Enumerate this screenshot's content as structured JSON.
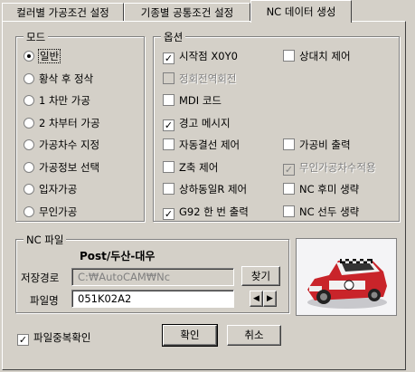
{
  "tabs": [
    {
      "label": "컬러별 가공조건 설정"
    },
    {
      "label": "기종별 공통조건 설정"
    },
    {
      "label": "NC 데이터 생성"
    }
  ],
  "mode_group": {
    "title": "모드",
    "options": [
      {
        "label": "일반",
        "selected": true
      },
      {
        "label": "황삭 후 정삭",
        "selected": false
      },
      {
        "label": "1 차만 가공",
        "selected": false
      },
      {
        "label": "2 차부터 가공",
        "selected": false
      },
      {
        "label": "가공차수 지정",
        "selected": false
      },
      {
        "label": "가공정보 선택",
        "selected": false
      },
      {
        "label": "입자가공",
        "selected": false
      },
      {
        "label": "무인가공",
        "selected": false
      }
    ]
  },
  "options_group": {
    "title": "옵션",
    "left": [
      {
        "label": "시작점 X0Y0",
        "checked": true,
        "enabled": true
      },
      {
        "label": "정회전역회전",
        "checked": false,
        "enabled": false
      },
      {
        "label": "MDI 코드",
        "checked": false,
        "enabled": true
      },
      {
        "label": "경고 메시지",
        "checked": true,
        "enabled": true
      },
      {
        "label": "자동결선 제어",
        "checked": false,
        "enabled": true
      },
      {
        "label": "Z축 제어",
        "checked": false,
        "enabled": true
      },
      {
        "label": "상하동일R 제어",
        "checked": false,
        "enabled": true
      },
      {
        "label": "G92 한 번 출력",
        "checked": true,
        "enabled": true
      }
    ],
    "right": [
      {
        "label": "상대치 제어",
        "checked": false,
        "enabled": true
      },
      {
        "label": "가공비 출력",
        "checked": false,
        "enabled": true
      },
      {
        "label": "무인가공차수적용",
        "checked": true,
        "enabled": false
      },
      {
        "label": "NC 후미 생략",
        "checked": false,
        "enabled": true
      },
      {
        "label": "NC 선두 생략",
        "checked": false,
        "enabled": true
      }
    ]
  },
  "nc_file_group": {
    "title": "NC 파일",
    "machine": "Post/두산-대우",
    "path_label": "저장경로",
    "path_value": "C:₩AutoCAM₩Nc",
    "browse_label": "찾기",
    "filename_label": "파일명",
    "filename_value": "051K02A2"
  },
  "footer": {
    "dup_check_label": "파일중복확인",
    "dup_check_checked": true,
    "ok_label": "확인",
    "cancel_label": "취소"
  }
}
